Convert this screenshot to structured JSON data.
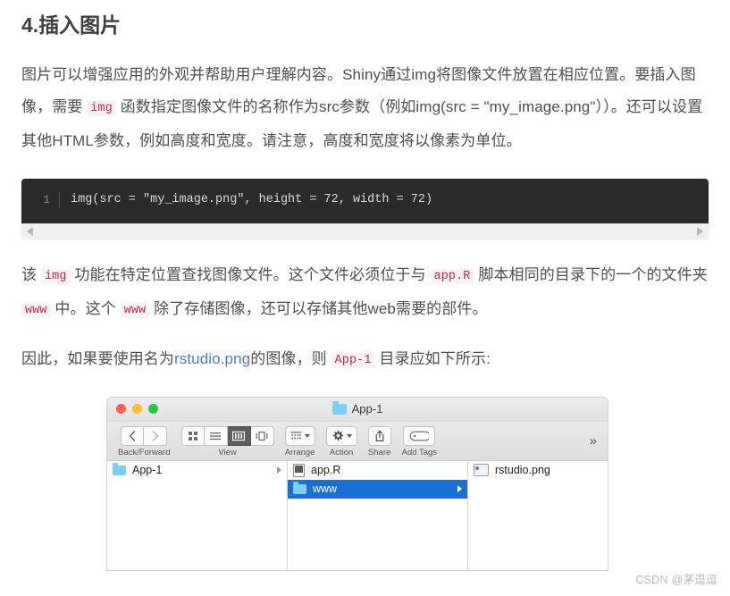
{
  "article": {
    "heading": "4.插入图片",
    "paragraph1": {
      "seg1": "图片可以增强应用的外观并帮助用户理解内容。Shiny通过img将图像文件放置在相应位置。要插入图像，需要 ",
      "code1": "img",
      "seg2": " 函数指定图像文件的名称作为src参数（例如img(src = \"my_image.png\"））。还可以设置其他HTML参数，例如高度和宽度。请注意，高度和宽度将以像素为单位。"
    },
    "paragraph2": {
      "seg1": "该 ",
      "code1": "img",
      "seg2": " 功能在特定位置查找图像文件。这个文件必须位于与 ",
      "code2": "app.R",
      "seg3": " 脚本相同的目录下的一个的文件夹 ",
      "code3": "www",
      "seg4": " 中。这个 ",
      "code4": "www",
      "seg5": " 除了存储图像，还可以存储其他web需要的部件。"
    },
    "paragraph3": {
      "seg1": "因此，如果要使用名为",
      "link1": "rstudio.png",
      "seg2": "的图像，则 ",
      "code1": "App-1",
      "seg3": " 目录应如下所示:"
    }
  },
  "code_block": {
    "line_number": "1",
    "content": "img(src = \"my_image.png\", height = 72, width = 72)",
    "scroll_left_icon": "triangle-left-icon",
    "scroll_right_icon": "triangle-right-icon"
  },
  "finder": {
    "title": "App-1",
    "title_folder_icon": "folder-icon",
    "traffic_lights": [
      "close",
      "minimize",
      "zoom"
    ],
    "toolbar": [
      {
        "label": "Back/Forward",
        "buttons": [
          "chevron-left-icon",
          "chevron-right-icon"
        ]
      },
      {
        "label": "View",
        "buttons": [
          "icon-view-icon",
          "list-view-icon",
          "column-view-icon",
          "gallery-view-icon"
        ],
        "selected_index": 2
      },
      {
        "label": "Arrange",
        "buttons": [
          "arrange-grid-icon",
          "chevron-down-icon"
        ]
      },
      {
        "label": "Action",
        "buttons": [
          "gear-icon",
          "chevron-down-icon"
        ]
      },
      {
        "label": "Share",
        "buttons": [
          "share-upload-icon"
        ]
      },
      {
        "label": "Add Tags",
        "buttons": [
          "tag-icon"
        ]
      }
    ],
    "overflow_label": "»",
    "columns": [
      {
        "rows": [
          {
            "name": "App-1",
            "icon": "folder-icon",
            "selected": false,
            "has_disclosure": true
          }
        ]
      },
      {
        "rows": [
          {
            "name": "app.R",
            "icon": "document-icon",
            "selected": false,
            "has_disclosure": false
          },
          {
            "name": "www",
            "icon": "folder-icon",
            "selected": true,
            "has_disclosure": true
          }
        ]
      },
      {
        "rows": [
          {
            "name": "rstudio.png",
            "icon": "image-icon",
            "selected": false,
            "has_disclosure": false
          }
        ]
      }
    ]
  },
  "watermark": "CSDN @茅逗逗",
  "colors": {
    "inline_code": "#c7254e",
    "inline_code_bg": "#f7f2f4",
    "link": "#4a7ebb",
    "code_block_bg": "#2b2b2b",
    "selection_blue": "#1a6fd4",
    "folder_blue": "#7ecdf4"
  }
}
